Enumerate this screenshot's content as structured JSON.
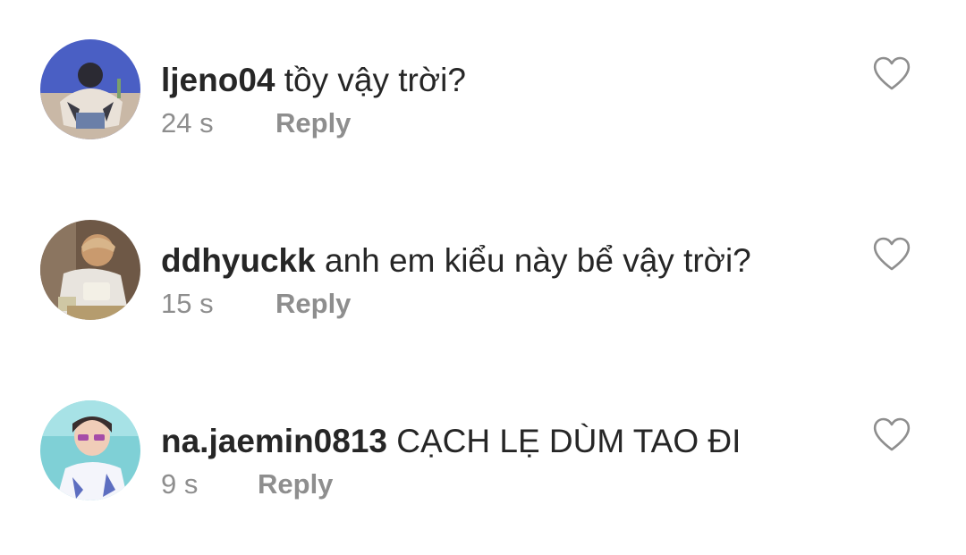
{
  "comments": [
    {
      "username": "ljeno04",
      "text": "tồy vậy trời?",
      "time": "24 s",
      "reply_label": "Reply",
      "avatar_icon": "avatar-photo",
      "like_icon": "heart-outline-icon"
    },
    {
      "username": "ddhyuckk",
      "text": "anh em kiểu này bể vậy trời?",
      "time": "15 s",
      "reply_label": "Reply",
      "avatar_icon": "avatar-photo",
      "like_icon": "heart-outline-icon"
    },
    {
      "username": "na.jaemin0813",
      "text": "CẠCH LẸ DÙM TAO ĐI",
      "time": "9 s",
      "reply_label": "Reply",
      "avatar_icon": "avatar-photo",
      "like_icon": "heart-outline-icon"
    }
  ],
  "colors": {
    "text_primary": "#262626",
    "text_secondary": "#8e8e8e",
    "background": "#ffffff"
  }
}
